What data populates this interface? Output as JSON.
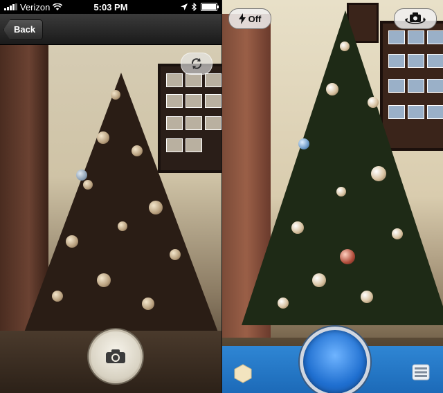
{
  "status_bar": {
    "carrier": "Verizon",
    "time": "5:03 PM"
  },
  "nav": {
    "back_label": "Back"
  },
  "left_camera": {
    "switch_icon": "camera-flip-icon",
    "shutter_icon": "camera-icon"
  },
  "right_camera": {
    "flash_label": "Off",
    "flash_icon": "lightning-bolt-icon",
    "switch_icon": "camera-rotate-icon",
    "left_icon": "hexagon-icon",
    "right_icon": "menu-icon"
  },
  "colors": {
    "accent_blue": "#2f86d4",
    "shutter_blue": "#1f6fd0"
  }
}
